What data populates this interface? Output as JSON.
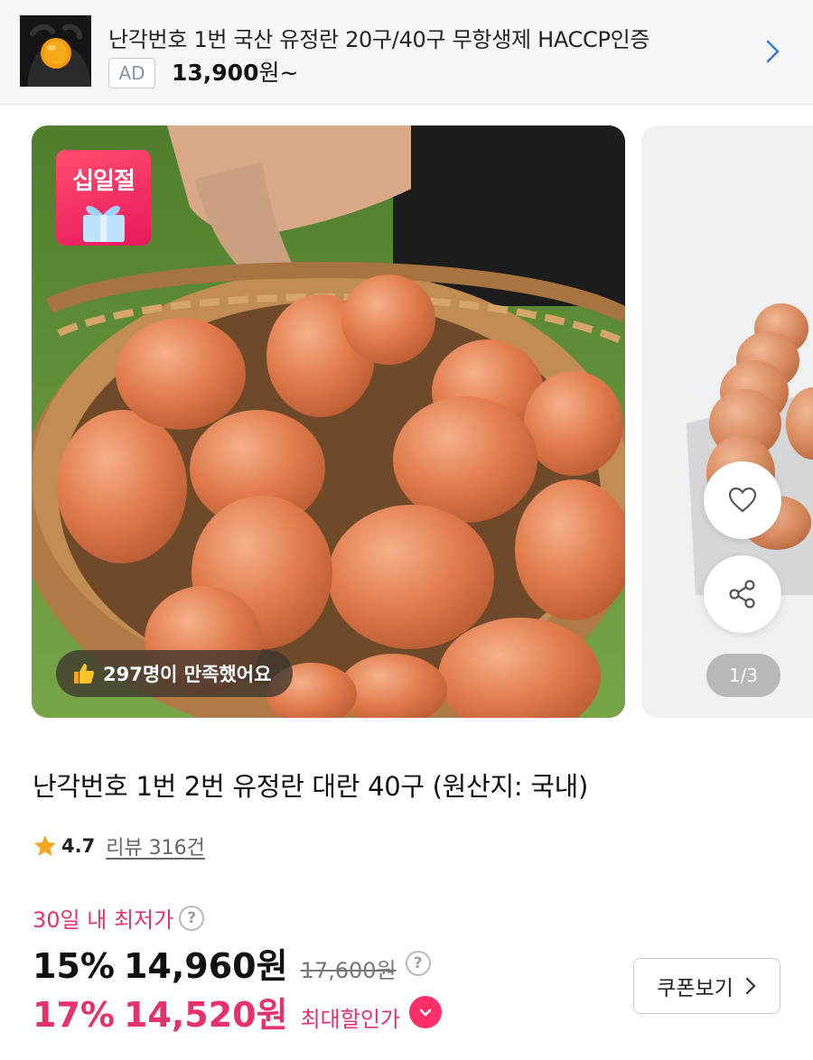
{
  "ad": {
    "title": "난각번호 1번 국산 유정란 20구/40구 무항생제 HACCP인증",
    "badge": "AD",
    "price": "13,900",
    "price_suffix": "원~",
    "thumbnail_icon": "egg-yolk-in-gloved-hand-image",
    "chevron_icon": "chevron-right-icon"
  },
  "gallery": {
    "event_sticker": "십일절",
    "satisfied_text": "297명이 만족했어요",
    "pager": "1/3",
    "like_icon": "heart-icon",
    "share_icon": "share-icon"
  },
  "product": {
    "title": "난각번호 1번 2번 유정란 대란 40구 (원산지: 국내)",
    "rating": "4.7",
    "review_text": "리뷰 316건"
  },
  "pricing": {
    "lowest_label": "30일 내 최저가",
    "discount": "15%",
    "price": "14,960원",
    "original_price": "17,600원",
    "max_discount": "17%",
    "max_price": "14,520원",
    "max_label": "최대할인가",
    "help_glyph": "?"
  },
  "coupon": {
    "label": "쿠폰보기"
  },
  "colors": {
    "accent_pink": "#e6326b",
    "badge_pink": "#ff2f6a",
    "star_gold": "#f5a623"
  }
}
